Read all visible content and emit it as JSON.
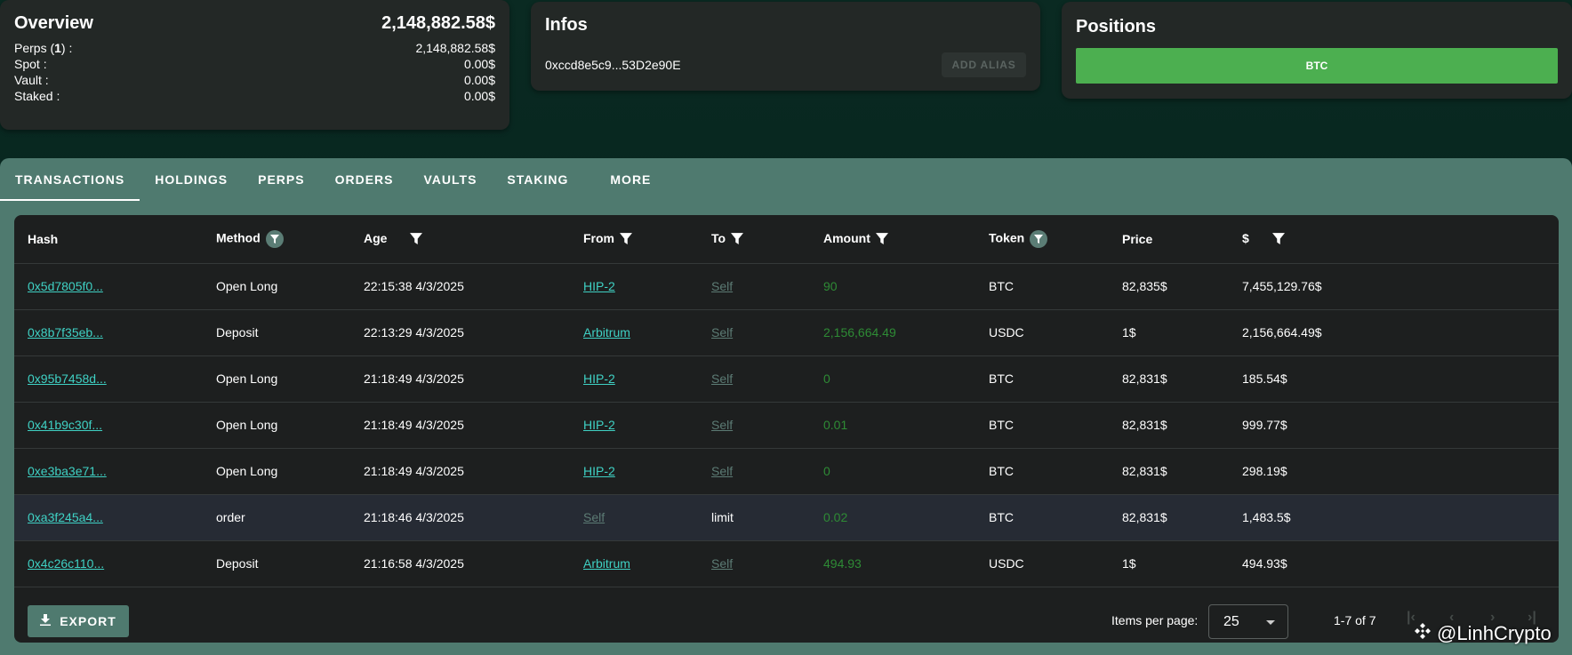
{
  "overview": {
    "title": "Overview",
    "total": "2,148,882.58$",
    "rows": [
      {
        "label_pre": "Perps (",
        "label_num": "1",
        "label_post": ") :",
        "value": "2,148,882.58$"
      },
      {
        "label": "Spot :",
        "value": "0.00$"
      },
      {
        "label": "Vault :",
        "value": "0.00$"
      },
      {
        "label": "Staked :",
        "value": "0.00$"
      }
    ]
  },
  "infos": {
    "title": "Infos",
    "address": "0xccd8e5c9...53D2e90E",
    "alias_button": "ADD ALIAS"
  },
  "positions": {
    "title": "Positions",
    "button": "BTC",
    "button_color": "#4caf50"
  },
  "tabs": [
    "TRANSACTIONS",
    "HOLDINGS",
    "PERPS",
    "ORDERS",
    "VAULTS",
    "STAKING",
    "MORE"
  ],
  "active_tab": "TRANSACTIONS",
  "table": {
    "headers": [
      "Hash",
      "Method",
      "Age",
      "From",
      "To",
      "Amount",
      "Token",
      "Price",
      "$"
    ],
    "rows": [
      {
        "hash": "0x5d7805f0...",
        "method": "Open Long",
        "age": "22:15:38 4/3/2025",
        "from": "HIP-2",
        "to": "Self",
        "amount": "90",
        "token": "BTC",
        "price": "82,835$",
        "usd": "7,455,129.76$"
      },
      {
        "hash": "0x8b7f35eb...",
        "method": "Deposit",
        "age": "22:13:29 4/3/2025",
        "from": "Arbitrum",
        "to": "Self",
        "amount": "2,156,664.49",
        "token": "USDC",
        "price": "1$",
        "usd": "2,156,664.49$"
      },
      {
        "hash": "0x95b7458d...",
        "method": "Open Long",
        "age": "21:18:49 4/3/2025",
        "from": "HIP-2",
        "to": "Self",
        "amount": "0",
        "token": "BTC",
        "price": "82,831$",
        "usd": "185.54$"
      },
      {
        "hash": "0x41b9c30f...",
        "method": "Open Long",
        "age": "21:18:49 4/3/2025",
        "from": "HIP-2",
        "to": "Self",
        "amount": "0.01",
        "token": "BTC",
        "price": "82,831$",
        "usd": "999.77$"
      },
      {
        "hash": "0xe3ba3e71...",
        "method": "Open Long",
        "age": "21:18:49 4/3/2025",
        "from": "HIP-2",
        "to": "Self",
        "amount": "0",
        "token": "BTC",
        "price": "82,831$",
        "usd": "298.19$"
      },
      {
        "hash": "0xa3f245a4...",
        "method": "order",
        "age": "21:18:46 4/3/2025",
        "from": "Self",
        "to": "limit",
        "amount": "0.02",
        "token": "BTC",
        "price": "82,831$",
        "usd": "1,483.5$"
      },
      {
        "hash": "0x4c26c110...",
        "method": "Deposit",
        "age": "21:16:58 4/3/2025",
        "from": "Arbitrum",
        "to": "Self",
        "amount": "494.93",
        "token": "USDC",
        "price": "1$",
        "usd": "494.93$"
      }
    ]
  },
  "footer": {
    "export_label": "EXPORT",
    "items_per_page_label": "Items per page:",
    "items_per_page_value": "25",
    "range": "1-7 of 7"
  },
  "watermark": "@LinhCrypto",
  "colors": {
    "accent": "#4f7a6f",
    "link": "#3fd1c4",
    "amount": "#2e8b35",
    "muted_link": "#5c7b74"
  }
}
